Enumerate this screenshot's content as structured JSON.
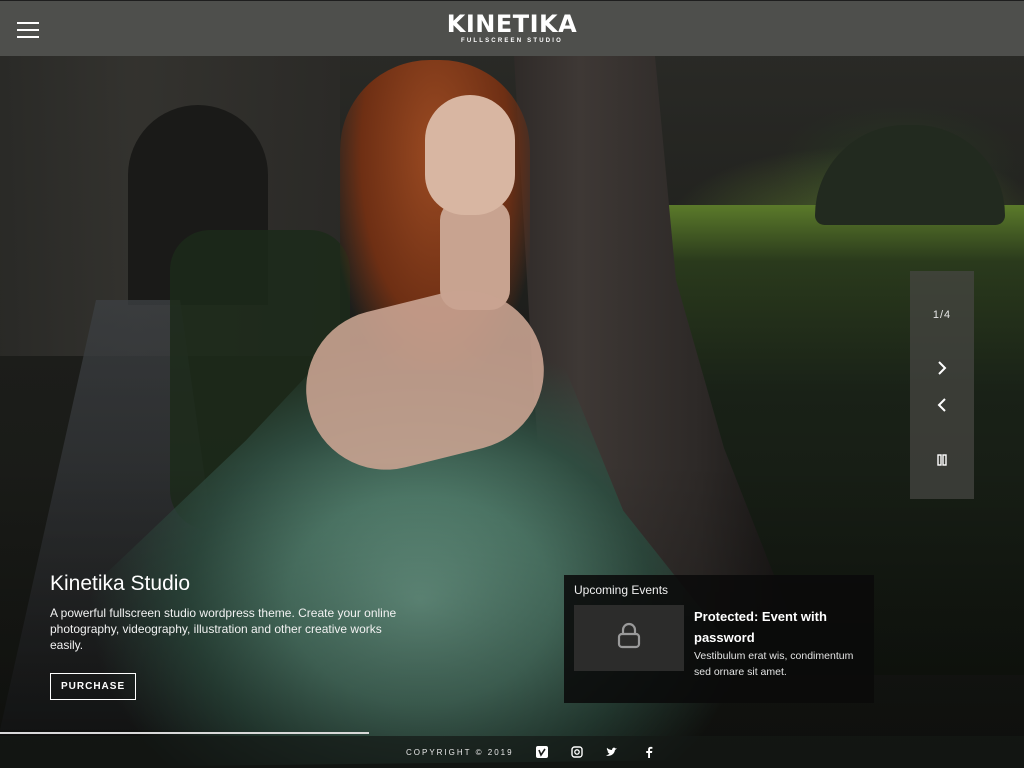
{
  "header": {
    "logo_title": "KINETIKA",
    "logo_subtitle": "FULLSCREEN STUDIO",
    "menu_icon": "hamburger-menu-icon"
  },
  "slider": {
    "counter": "1/4",
    "current": 1,
    "total": 4,
    "progress": 0.36,
    "next_icon": "chevron-right-icon",
    "prev_icon": "chevron-left-icon",
    "pause_icon": "pause-icon"
  },
  "hero": {
    "title": "Kinetika Studio",
    "description": "A powerful fullscreen studio wordpress theme. Create your online photography, videography, illustration and other creative works easily.",
    "button_label": "PURCHASE"
  },
  "events": {
    "heading": "Upcoming Events",
    "items": [
      {
        "title": "Protected: Event with password",
        "excerpt": "Vestibulum erat wis, condimentum sed ornare sit amet.",
        "thumb_icon": "lock-icon"
      }
    ]
  },
  "footer": {
    "copyright": "COPYRIGHT © 2019",
    "social": [
      "vimeo-icon",
      "instagram-icon",
      "twitter-icon",
      "facebook-icon"
    ]
  },
  "colors": {
    "header_bg": "#4e4f4c",
    "panel_bg": "#0a0a0a",
    "text": "#ffffff"
  }
}
